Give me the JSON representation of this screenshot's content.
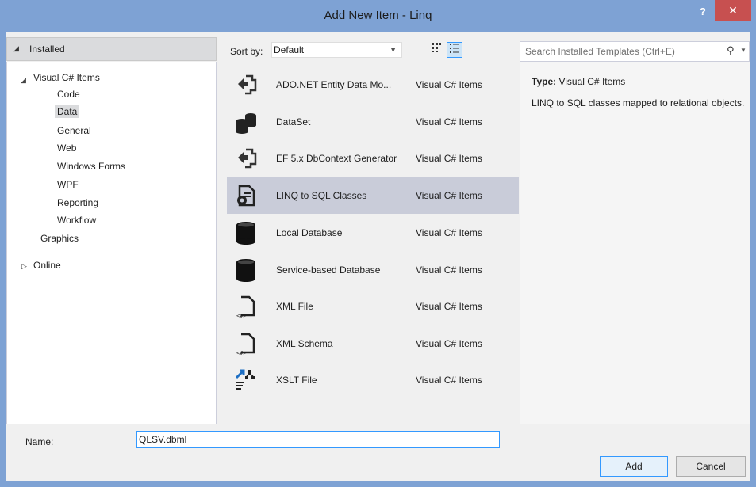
{
  "window": {
    "title": "Add New Item - Linq",
    "help_label": "?",
    "close_label": "✕"
  },
  "left": {
    "installed_label": "Installed",
    "tree": [
      {
        "label": "Visual C# Items",
        "level": 0,
        "expanded": true
      },
      {
        "label": "Code",
        "level": 1
      },
      {
        "label": "Data",
        "level": 1,
        "selected": true
      },
      {
        "label": "General",
        "level": 1
      },
      {
        "label": "Web",
        "level": 1
      },
      {
        "label": "Windows Forms",
        "level": 1
      },
      {
        "label": "WPF",
        "level": 1
      },
      {
        "label": "Reporting",
        "level": 1
      },
      {
        "label": "Workflow",
        "level": 1
      },
      {
        "label": "Graphics",
        "level": 0
      }
    ],
    "online_label": "Online"
  },
  "toolbar": {
    "sort_label": "Sort by:",
    "sort_value": "Default"
  },
  "items": [
    {
      "name": "ADO.NET Entity Data Mo...",
      "category": "Visual C# Items",
      "icon": "entity-model-icon"
    },
    {
      "name": "DataSet",
      "category": "Visual C# Items",
      "icon": "dataset-icon"
    },
    {
      "name": "EF 5.x DbContext Generator",
      "category": "Visual C# Items",
      "icon": "entity-model-icon"
    },
    {
      "name": "LINQ to SQL Classes",
      "category": "Visual C# Items",
      "icon": "linq-to-sql-icon",
      "selected": true
    },
    {
      "name": "Local Database",
      "category": "Visual C# Items",
      "icon": "database-icon"
    },
    {
      "name": "Service-based Database",
      "category": "Visual C# Items",
      "icon": "database-icon"
    },
    {
      "name": "XML File",
      "category": "Visual C# Items",
      "icon": "xml-file-icon"
    },
    {
      "name": "XML Schema",
      "category": "Visual C# Items",
      "icon": "xml-file-icon"
    },
    {
      "name": "XSLT File",
      "category": "Visual C# Items",
      "icon": "xslt-file-icon"
    }
  ],
  "search": {
    "placeholder": "Search Installed Templates (Ctrl+E)"
  },
  "details": {
    "type_label": "Type:",
    "type_value": "Visual C# Items",
    "description": "LINQ to SQL classes mapped to relational objects."
  },
  "footer": {
    "name_label": "Name:",
    "name_value": "QLSV.dbml",
    "add_label": "Add",
    "cancel_label": "Cancel"
  },
  "colors": {
    "titlebar": "#7ea2d4",
    "close_button": "#c75050",
    "selection": "#c9ccd9",
    "focus_border": "#3399ff"
  }
}
